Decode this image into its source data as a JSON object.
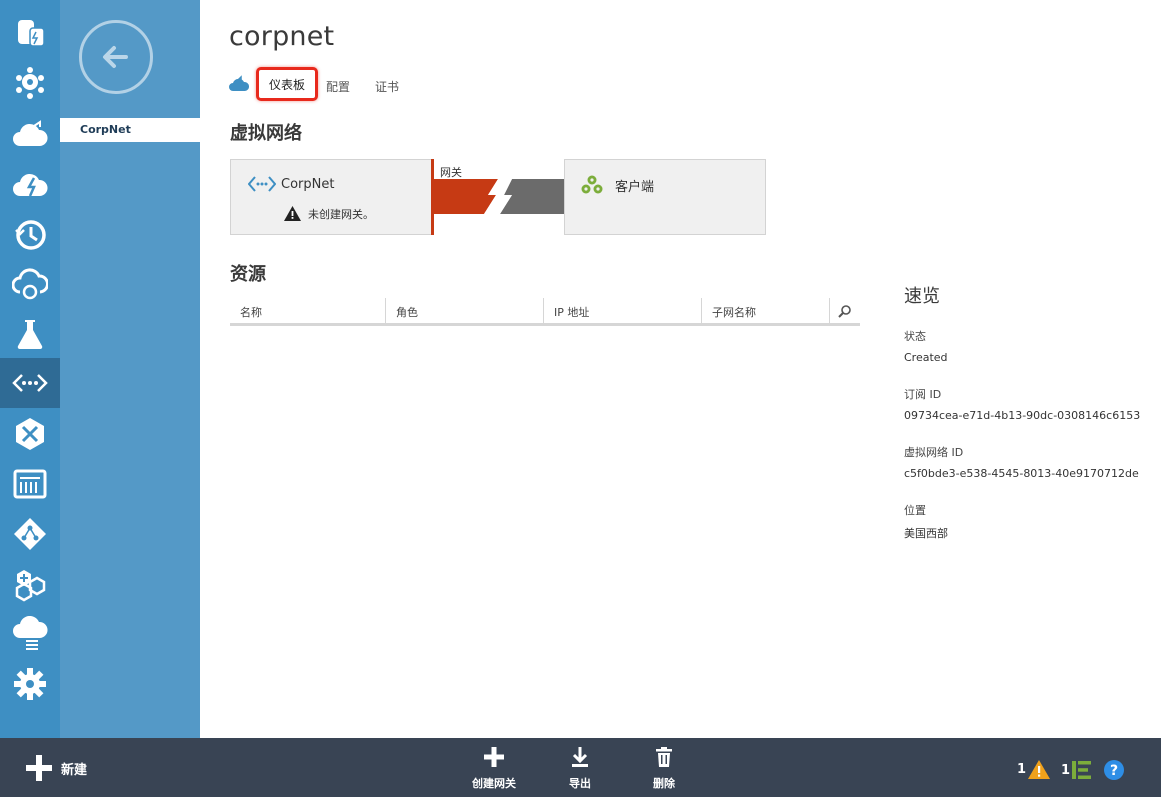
{
  "app": {
    "title": "corpnet"
  },
  "rail": {
    "items": [
      {
        "icon": "database-icon",
        "label": ""
      },
      {
        "icon": "hdinsight-icon",
        "label": ""
      },
      {
        "icon": "cloud-services-icon",
        "label": ""
      },
      {
        "icon": "mobile-services-icon",
        "label": ""
      },
      {
        "icon": "scheduler-icon",
        "label": ""
      },
      {
        "icon": "cloud-sync-icon",
        "label": ""
      },
      {
        "icon": "lab-icon",
        "label": ""
      },
      {
        "icon": "networks-icon",
        "label": "",
        "active": true
      },
      {
        "icon": "traffic-manager-icon",
        "label": ""
      },
      {
        "icon": "management-portal-icon",
        "label": ""
      },
      {
        "icon": "active-directory-icon",
        "label": ""
      },
      {
        "icon": "add-ons-icon",
        "label": ""
      },
      {
        "icon": "cloud-list-icon",
        "label": ""
      },
      {
        "icon": "settings-icon",
        "label": ""
      }
    ]
  },
  "panel": {
    "selected_item": "CorpNet"
  },
  "tabs": {
    "dashboard": "仪表板",
    "config": "配置",
    "cert": "证书"
  },
  "vnet": {
    "heading": "虚拟网络",
    "name": "CorpNet",
    "warning": "未创建网关。",
    "gateway_label": "网关",
    "client_name": "客户端"
  },
  "resources": {
    "heading": "资源",
    "columns": [
      "名称",
      "角色",
      "IP 地址",
      "子网名称"
    ],
    "rows": []
  },
  "quick_glance": {
    "title": "速览",
    "items": [
      {
        "label": "状态",
        "value": "Created"
      },
      {
        "label": "订阅 ID",
        "value": "09734cea-e71d-4b13-90dc-0308146c6153"
      },
      {
        "label": "虚拟网络 ID",
        "value": "c5f0bde3-e538-4545-8013-40e9170712de"
      },
      {
        "label": "位置",
        "value": "美国西部"
      }
    ]
  },
  "cmdbar": {
    "new_label": "新建",
    "create_gateway": "创建网关",
    "export": "导出",
    "delete": "删除",
    "warnings_count": "1",
    "tasks_count": "1"
  },
  "colors": {
    "rail_bg": "#3e8fc3",
    "rail_active": "#2f6b95",
    "panel_bg": "#5499c7",
    "cmdbar_bg": "#394454",
    "gateway_red": "#c63a14",
    "gateway_gray": "#6b6b6b",
    "highlight_red": "#e8291c",
    "warning_orange": "#f0a11b",
    "help_blue": "#2e8ee6"
  }
}
